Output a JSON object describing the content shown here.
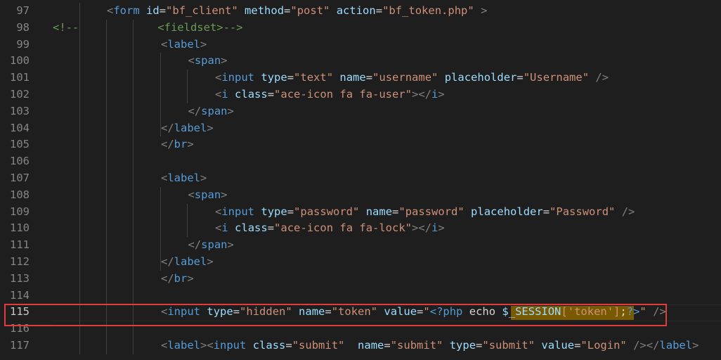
{
  "editor": {
    "language": "html/php",
    "current_line": "115",
    "lines": [
      {
        "n": "97",
        "indent": 2,
        "tokens": [
          [
            "t",
            "<"
          ],
          [
            "tn",
            "form"
          ],
          [
            "k",
            " "
          ],
          [
            "a",
            "id"
          ],
          [
            "eq",
            "="
          ],
          [
            "s",
            "\"bf_client\""
          ],
          [
            "k",
            " "
          ],
          [
            "a",
            "method"
          ],
          [
            "eq",
            "="
          ],
          [
            "s",
            "\"post\""
          ],
          [
            "k",
            " "
          ],
          [
            "a",
            "action"
          ],
          [
            "eq",
            "="
          ],
          [
            "s",
            "\"bf_token.php\""
          ],
          [
            "k",
            " "
          ],
          [
            "t",
            ">"
          ]
        ]
      },
      {
        "n": "98",
        "indent": 0,
        "tokens": [
          [
            "c",
            "<!--            "
          ],
          [
            "c",
            "<fieldset>-->"
          ]
        ]
      },
      {
        "n": "99",
        "indent": 4,
        "tokens": [
          [
            "t",
            "<"
          ],
          [
            "tn",
            "label"
          ],
          [
            "t",
            ">"
          ]
        ]
      },
      {
        "n": "100",
        "indent": 5,
        "tokens": [
          [
            "t",
            "<"
          ],
          [
            "tn",
            "span"
          ],
          [
            "t",
            ">"
          ]
        ]
      },
      {
        "n": "101",
        "indent": 6,
        "tokens": [
          [
            "t",
            "<"
          ],
          [
            "tn",
            "input"
          ],
          [
            "k",
            " "
          ],
          [
            "a",
            "type"
          ],
          [
            "eq",
            "="
          ],
          [
            "s",
            "\"text\""
          ],
          [
            "k",
            " "
          ],
          [
            "a",
            "name"
          ],
          [
            "eq",
            "="
          ],
          [
            "s",
            "\"username\""
          ],
          [
            "k",
            " "
          ],
          [
            "a",
            "placeholder"
          ],
          [
            "eq",
            "="
          ],
          [
            "s",
            "\"Username\""
          ],
          [
            "k",
            " "
          ],
          [
            "t",
            "/>"
          ]
        ]
      },
      {
        "n": "102",
        "indent": 6,
        "tokens": [
          [
            "t",
            "<"
          ],
          [
            "tn",
            "i"
          ],
          [
            "k",
            " "
          ],
          [
            "a",
            "class"
          ],
          [
            "eq",
            "="
          ],
          [
            "s",
            "\"ace-icon fa fa-user\""
          ],
          [
            "t",
            ">"
          ],
          [
            "t",
            "</"
          ],
          [
            "tn",
            "i"
          ],
          [
            "t",
            ">"
          ]
        ]
      },
      {
        "n": "103",
        "indent": 5,
        "tokens": [
          [
            "t",
            "</"
          ],
          [
            "tn",
            "span"
          ],
          [
            "t",
            ">"
          ]
        ]
      },
      {
        "n": "104",
        "indent": 4,
        "tokens": [
          [
            "t",
            "</"
          ],
          [
            "tn",
            "label"
          ],
          [
            "t",
            ">"
          ]
        ]
      },
      {
        "n": "105",
        "indent": 4,
        "tokens": [
          [
            "t",
            "</"
          ],
          [
            "tn",
            "br"
          ],
          [
            "t",
            ">"
          ]
        ]
      },
      {
        "n": "106",
        "indent": 4,
        "tokens": []
      },
      {
        "n": "107",
        "indent": 4,
        "tokens": [
          [
            "t",
            "<"
          ],
          [
            "tn",
            "label"
          ],
          [
            "t",
            ">"
          ]
        ]
      },
      {
        "n": "108",
        "indent": 5,
        "tokens": [
          [
            "t",
            "<"
          ],
          [
            "tn",
            "span"
          ],
          [
            "t",
            ">"
          ]
        ]
      },
      {
        "n": "109",
        "indent": 6,
        "tokens": [
          [
            "t",
            "<"
          ],
          [
            "tn",
            "input"
          ],
          [
            "k",
            " "
          ],
          [
            "a",
            "type"
          ],
          [
            "eq",
            "="
          ],
          [
            "s",
            "\"password\""
          ],
          [
            "k",
            " "
          ],
          [
            "a",
            "name"
          ],
          [
            "eq",
            "="
          ],
          [
            "s",
            "\"password\""
          ],
          [
            "k",
            " "
          ],
          [
            "a",
            "placeholder"
          ],
          [
            "eq",
            "="
          ],
          [
            "s",
            "\"Password\""
          ],
          [
            "k",
            " "
          ],
          [
            "t",
            "/>"
          ]
        ]
      },
      {
        "n": "110",
        "indent": 6,
        "tokens": [
          [
            "t",
            "<"
          ],
          [
            "tn",
            "i"
          ],
          [
            "k",
            " "
          ],
          [
            "a",
            "class"
          ],
          [
            "eq",
            "="
          ],
          [
            "s",
            "\"ace-icon fa fa-lock\""
          ],
          [
            "t",
            ">"
          ],
          [
            "t",
            "</"
          ],
          [
            "tn",
            "i"
          ],
          [
            "t",
            ">"
          ]
        ]
      },
      {
        "n": "111",
        "indent": 5,
        "tokens": [
          [
            "t",
            "</"
          ],
          [
            "tn",
            "span"
          ],
          [
            "t",
            ">"
          ]
        ]
      },
      {
        "n": "112",
        "indent": 4,
        "tokens": [
          [
            "t",
            "</"
          ],
          [
            "tn",
            "label"
          ],
          [
            "t",
            ">"
          ]
        ]
      },
      {
        "n": "113",
        "indent": 4,
        "tokens": [
          [
            "t",
            "</"
          ],
          [
            "tn",
            "br"
          ],
          [
            "t",
            ">"
          ]
        ]
      },
      {
        "n": "114",
        "indent": 4,
        "tokens": []
      },
      {
        "n": "115",
        "indent": 4,
        "tokens": [
          [
            "t",
            "<"
          ],
          [
            "tn",
            "input"
          ],
          [
            "k",
            " "
          ],
          [
            "a",
            "type"
          ],
          [
            "eq",
            "="
          ],
          [
            "s",
            "\"hidden\""
          ],
          [
            "k",
            " "
          ],
          [
            "a",
            "name"
          ],
          [
            "eq",
            "="
          ],
          [
            "s",
            "\"token\""
          ],
          [
            "k",
            " "
          ],
          [
            "a",
            "value"
          ],
          [
            "eq",
            "="
          ],
          [
            "s",
            "\""
          ],
          [
            "php",
            "<?php"
          ],
          [
            "k",
            " echo "
          ],
          [
            "v",
            "$_SESSION"
          ],
          [
            "s",
            "['token']"
          ],
          [
            "k",
            ";"
          ],
          [
            "php",
            "?>"
          ],
          [
            "s",
            "\""
          ],
          [
            "k",
            " "
          ],
          [
            "t",
            "/>"
          ]
        ]
      },
      {
        "n": "116",
        "indent": 4,
        "tokens": []
      },
      {
        "n": "117",
        "indent": 4,
        "tokens": [
          [
            "t",
            "<"
          ],
          [
            "tn",
            "label"
          ],
          [
            "t",
            "><"
          ],
          [
            "tn",
            "input"
          ],
          [
            "k",
            " "
          ],
          [
            "a",
            "class"
          ],
          [
            "eq",
            "="
          ],
          [
            "s",
            "\"submit\""
          ],
          [
            "k",
            "  "
          ],
          [
            "a",
            "name"
          ],
          [
            "eq",
            "="
          ],
          [
            "s",
            "\"submit\""
          ],
          [
            "k",
            " "
          ],
          [
            "a",
            "type"
          ],
          [
            "eq",
            "="
          ],
          [
            "s",
            "\"submit\""
          ],
          [
            "k",
            " "
          ],
          [
            "a",
            "value"
          ],
          [
            "eq",
            "="
          ],
          [
            "s",
            "\"Login\""
          ],
          [
            "k",
            " "
          ],
          [
            "t",
            "/></"
          ],
          [
            "tn",
            "label"
          ],
          [
            "t",
            ">"
          ]
        ]
      }
    ]
  },
  "colors": {
    "background": "#1e1e1e",
    "highlight_border": "#e23b3b",
    "selection": "#7a5a00"
  }
}
